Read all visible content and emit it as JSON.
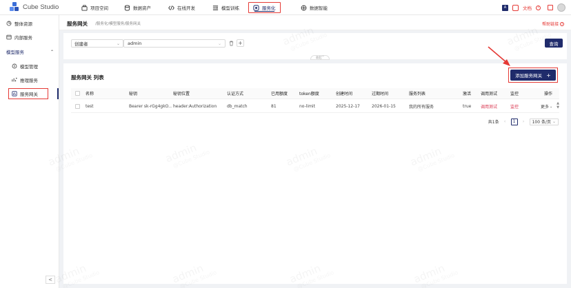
{
  "app": {
    "name": "Cube Studio"
  },
  "nav": {
    "items": [
      {
        "label": "项目空间",
        "icon": "project-icon"
      },
      {
        "label": "数据资产",
        "icon": "database-icon"
      },
      {
        "label": "在线开发",
        "icon": "code-icon"
      },
      {
        "label": "模型训练",
        "icon": "training-icon"
      },
      {
        "label": "服务化",
        "icon": "service-icon",
        "active": true
      },
      {
        "label": "数据智能",
        "icon": "intelligence-icon"
      }
    ],
    "right": {
      "docs_label": "文档"
    }
  },
  "sidebar": {
    "items": [
      {
        "label": "整体资源",
        "icon": "resource-icon"
      },
      {
        "label": "内部服务",
        "icon": "internal-service-icon"
      }
    ],
    "group": {
      "label": "模型服务",
      "children": [
        {
          "label": "模型管理",
          "icon": "model-manage-icon"
        },
        {
          "label": "推理服务",
          "icon": "inference-icon"
        },
        {
          "label": "服务网关",
          "icon": "gateway-icon",
          "selected": true
        }
      ]
    },
    "collapse_label": "<"
  },
  "page": {
    "title": "服务网关",
    "breadcrumb": "/服务化/模型服务/服务网关",
    "help": "帮助链接"
  },
  "filter": {
    "field": "创建者",
    "value": "admin",
    "query_label": "查询",
    "fold_label": "收起"
  },
  "table": {
    "title": "服务网关 列表",
    "add_label": "添加服务网关",
    "columns": [
      "名称",
      "秘钥",
      "秘钥位置",
      "认证方式",
      "已用额度",
      "token额度",
      "创建时间",
      "过期时间",
      "服务列表",
      "激活",
      "调用测试",
      "监控",
      "操作"
    ],
    "rows": [
      [
        "test",
        "Bearer sk-rGg4gkO...",
        "header:Authorization",
        "db_match",
        "81",
        "no-limit",
        "2025-12-17",
        "2026-01-15",
        "我的所有服务",
        "true",
        "调用测试",
        "监控",
        "更多"
      ]
    ]
  },
  "pagination": {
    "total_label": "共1条",
    "page": "1",
    "page_size": "100 条/页"
  },
  "watermark": {
    "text": "admin",
    "sub": "@Cube Studio"
  },
  "colors": {
    "primary": "#1f2b6b",
    "highlight": "#e53935",
    "link": "#d9364f"
  }
}
